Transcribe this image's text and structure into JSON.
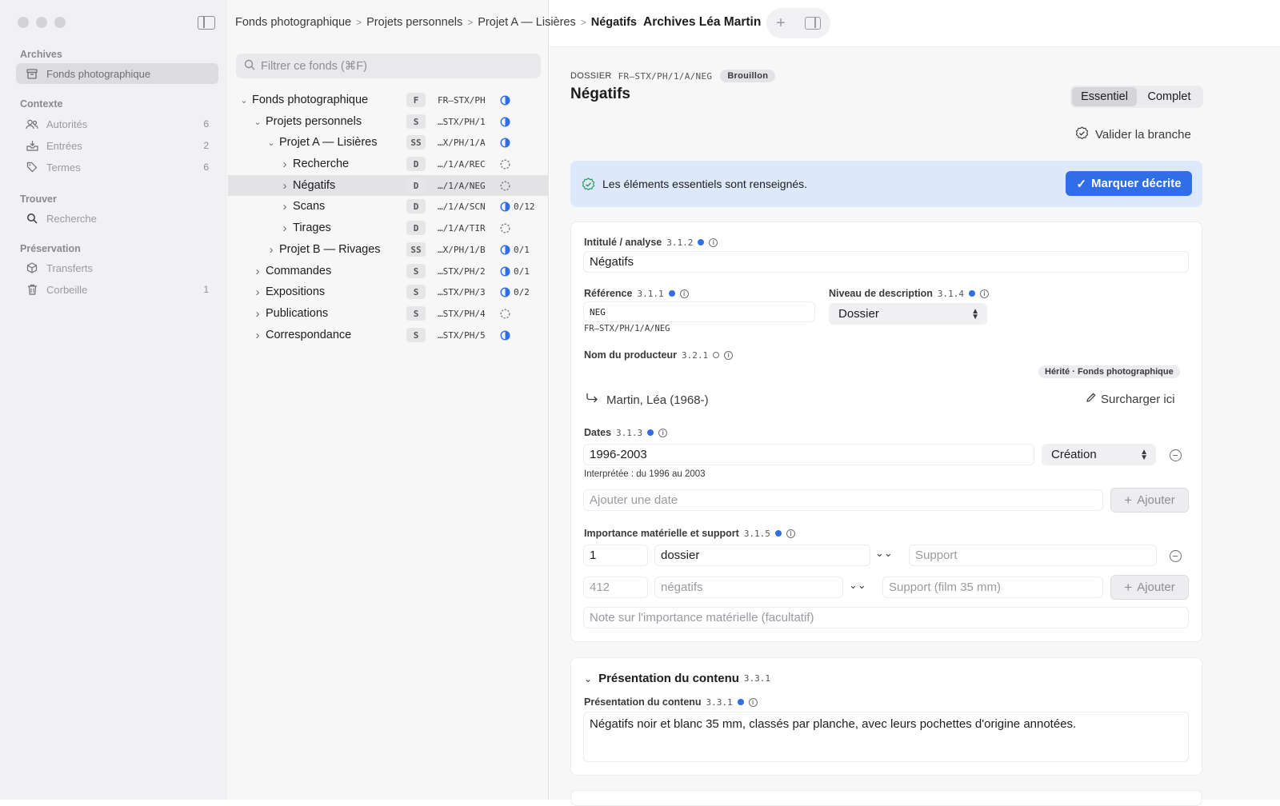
{
  "sidebar": {
    "sections": [
      {
        "title": "Archives"
      },
      {
        "title": "Contexte"
      },
      {
        "title": "Trouver"
      },
      {
        "title": "Préservation"
      }
    ],
    "items": [
      {
        "label": "Fonds photographique",
        "icon": "archive-box-icon",
        "count": ""
      },
      {
        "label": "Autorités",
        "icon": "people-icon",
        "count": "6"
      },
      {
        "label": "Entrées",
        "icon": "inbox-tray-icon",
        "count": "2"
      },
      {
        "label": "Termes",
        "icon": "tag-icon",
        "count": "6"
      },
      {
        "label": "Recherche",
        "icon": "search-icon",
        "count": ""
      },
      {
        "label": "Transferts",
        "icon": "package-icon",
        "count": ""
      },
      {
        "label": "Corbeille",
        "icon": "trash-icon",
        "count": "1"
      }
    ]
  },
  "breadcrumb": [
    "Fonds photographique",
    "Projets personnels",
    "Projet A — Lisières",
    "Négatifs"
  ],
  "window_title": "Archives Léa Martin",
  "filter": {
    "placeholder": "Filtrer ce fonds (⌘F)"
  },
  "tree": [
    {
      "label": "Fonds photographique",
      "badge": "F",
      "code": "FR–STX/PH",
      "status": "partial",
      "progress": ""
    },
    {
      "label": "Projets personnels",
      "badge": "S",
      "code": "…STX/PH/1",
      "status": "partial",
      "progress": ""
    },
    {
      "label": "Projet A — Lisières",
      "badge": "SS",
      "code": "…X/PH/1/A",
      "status": "partial",
      "progress": ""
    },
    {
      "label": "Recherche",
      "badge": "D",
      "code": "…/1/A/REC",
      "status": "empty",
      "progress": ""
    },
    {
      "label": "Négatifs",
      "badge": "D",
      "code": "…/1/A/NEG",
      "status": "empty",
      "progress": ""
    },
    {
      "label": "Scans",
      "badge": "D",
      "code": "…/1/A/SCN",
      "status": "partial",
      "progress": "0/12"
    },
    {
      "label": "Tirages",
      "badge": "D",
      "code": "…/1/A/TIR",
      "status": "empty",
      "progress": ""
    },
    {
      "label": "Projet B — Rivages",
      "badge": "SS",
      "code": "…X/PH/1/B",
      "status": "partial",
      "progress": "0/1"
    },
    {
      "label": "Commandes",
      "badge": "S",
      "code": "…STX/PH/2",
      "status": "partial",
      "progress": "0/1"
    },
    {
      "label": "Expositions",
      "badge": "S",
      "code": "…STX/PH/3",
      "status": "partial",
      "progress": "0/2"
    },
    {
      "label": "Publications",
      "badge": "S",
      "code": "…STX/PH/4",
      "status": "empty",
      "progress": ""
    },
    {
      "label": "Correspondance",
      "badge": "S",
      "code": "…STX/PH/5",
      "status": "partial",
      "progress": ""
    }
  ],
  "detail": {
    "kind": "DOSSIER",
    "ref": "FR–STX/PH/1/A/NEG",
    "status_pill": "Brouillon",
    "title": "Négatifs",
    "mode_tabs": [
      "Essentiel",
      "Complet"
    ],
    "active_mode": "Essentiel",
    "validate_label": "Valider la branche",
    "banner_text": "Les éléments essentiels sont renseignés.",
    "mark_button": "Marquer décrite",
    "fields": {
      "title": {
        "label": "Intitulé / analyse",
        "num": "3.1.2",
        "value": "Négatifs"
      },
      "reference": {
        "label": "Référence",
        "num": "3.1.1",
        "value": "NEG",
        "full": "FR–STX/PH/1/A/NEG"
      },
      "level": {
        "label": "Niveau de description",
        "num": "3.1.4",
        "value": "Dossier"
      },
      "producer": {
        "label": "Nom du producteur",
        "num": "3.2.1",
        "inherited_tag": "Hérité · Fonds photographique",
        "value": "Martin, Léa (1968-)",
        "override_label": "Surcharger ici"
      },
      "dates": {
        "label": "Dates",
        "num": "3.1.3",
        "value": "1996-2003",
        "type": "Création",
        "interpreted": "Interprétée : du 1996 au 2003",
        "add_placeholder": "Ajouter une date",
        "add_button": "Ajouter"
      },
      "extent": {
        "label": "Importance matérielle et support",
        "num": "3.1.5",
        "row1": {
          "qty": "1",
          "unit": "dossier",
          "support_placeholder": "Support"
        },
        "row2": {
          "qty_placeholder": "412",
          "unit_placeholder": "négatifs",
          "support_placeholder": "Support (film 35 mm)",
          "add_button": "Ajouter"
        },
        "note_placeholder": "Note sur l'importance matérielle (facultatif)"
      }
    },
    "section2": {
      "title": "Présentation du contenu",
      "num": "3.3.1",
      "field_label": "Présentation du contenu",
      "field_num": "3.3.1",
      "value": "Négatifs noir et blanc 35 mm, classés par planche, avec leurs pochettes d'origine annotées."
    }
  },
  "colors": {
    "accent": "#2f6ee6",
    "banner": "#dde8fb",
    "sidebar_bg": "#f1f1f3"
  }
}
